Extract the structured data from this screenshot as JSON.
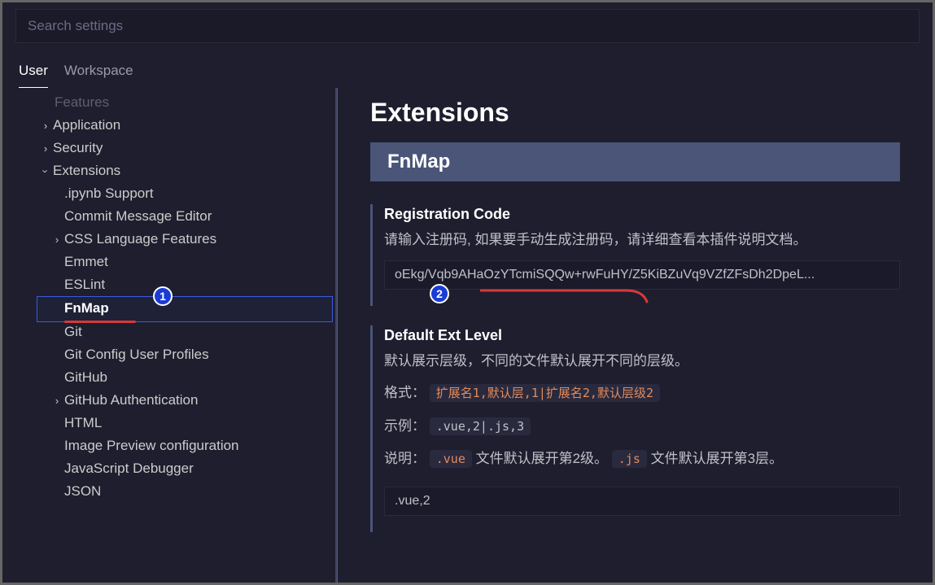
{
  "search": {
    "placeholder": "Search settings"
  },
  "tabs": {
    "user": "User",
    "workspace": "Workspace"
  },
  "sidebar": {
    "features": "Features",
    "application": "Application",
    "security": "Security",
    "extensions": "Extensions",
    "items": {
      "ipynb": ".ipynb Support",
      "commit": "Commit Message Editor",
      "css": "CSS Language Features",
      "emmet": "Emmet",
      "eslint": "ESLint",
      "fnmap": "FnMap",
      "git": "Git",
      "gitconfig": "Git Config User Profiles",
      "github": "GitHub",
      "githubauth": "GitHub Authentication",
      "html": "HTML",
      "imagepreview": "Image Preview configuration",
      "jsdebugger": "JavaScript Debugger",
      "json": "JSON"
    }
  },
  "content": {
    "heading": "Extensions",
    "section": "FnMap",
    "regcode": {
      "title": "Registration Code",
      "desc": "请输入注册码, 如果要手动生成注册码，请详细查看本插件说明文档。",
      "value": "oEkg/Vqb9AHaOzYTcmiSQQw+rwFuHY/Z5KiBZuVq9VZfZFsDh2DpeL..."
    },
    "extlevel": {
      "title": "Default Ext Level",
      "desc": "默认展示层级，不同的文件默认展开不同的层级。",
      "format_label": "格式：",
      "format_value": "扩展名1,默认层,1|扩展名2,默认层级2",
      "example_label": "示例：",
      "example_value": ".vue,2|.js,3",
      "explain_label": "说明：",
      "explain_vue": ".vue",
      "explain_text1": " 文件默认展开第2级。 ",
      "explain_js": ".js",
      "explain_text2": " 文件默认展开第3层。",
      "value": ".vue,2"
    }
  },
  "badges": {
    "one": "1",
    "two": "2"
  }
}
